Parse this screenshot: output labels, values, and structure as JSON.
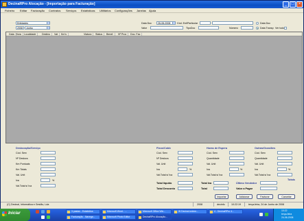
{
  "window": {
    "title": "DecinaRPro Alocação - [Importação para Facturação]",
    "controls": {
      "minimize": "_",
      "maximize": "□",
      "close": "×"
    }
  },
  "menu": [
    "Ficheiro",
    "Editar",
    "Facturação",
    "Contratos",
    "Serviços",
    "Estatísticas",
    "Utilitários",
    "Configurações",
    "Janelas",
    "Ajuda"
  ],
  "filters": {
    "type_value": "Entidades",
    "year_value": "2008",
    "month_value": "Junho",
    "data_doc_label": "Data Doc",
    "data_doc_value": "26-06-2008",
    "cod_label": "Cód. Ent/Particular",
    "valor_label": "Valor",
    "tipo_doc_label": "TipoDoc",
    "numero_label": "Número",
    "radio_data_doc": "Data Doc",
    "radio_data_transp": "Data Transp",
    "ver_todo_label": "Ver todo?"
  },
  "grid": {
    "columns": [
      "Data",
      "Hora",
      "Localidade",
      "Destino",
      "Vat",
      "Km's",
      "Viatura",
      "Status",
      "Benef.",
      "Nº Proc",
      "Doc. Fac"
    ]
  },
  "panels": {
    "desloc": {
      "title": "Deslocação/Serviço",
      "rows": [
        "Cód. Serv",
        "Nº Deslocs",
        "Km Pontuais",
        "Km Totais",
        "Val. Unit",
        "Iva",
        "Val.Total s/ Iva"
      ],
      "pct": "%"
    },
    "fixos": {
      "title": "Fixos/Cobb",
      "rows": [
        "Cód. Serv",
        "Nº Deslocs",
        "Val. Unit",
        "Iva",
        "Val.Total s/ Iva"
      ],
      "pct": "%"
    },
    "horas": {
      "title": "Horas de Espera",
      "rows": [
        "Cód. Serv",
        "Quantidade",
        "Val. Unit",
        "Iva",
        "Val.Total s/ Iva"
      ],
      "pct": "%"
    },
    "outras": {
      "title": "Outras/Ocasiões",
      "rows": [
        "Cód. Serv",
        "Quantidade",
        "Val. Unit",
        "Iva",
        "Val.Total s/ Iva"
      ],
      "pct": "%",
      "totais": "Totais"
    }
  },
  "totals": {
    "liquido": "Total liquido",
    "desconto": "Total Desconto",
    "iva": "Total Iva",
    "total": "Total",
    "ultimo_vendedor": "Último Vendedor",
    "valor_pagar": "Valor a Pagar"
  },
  "buttons": {
    "importar": "Importar",
    "adicionar": "Adicionar",
    "facturar": "Facturar",
    "cancelar": "Cancelar"
  },
  "status": {
    "company": "(C) Decinal, Informática e Gestão, Lda",
    "year": "2008",
    "user": "decinfo",
    "time": "10:22:19",
    "date": "terça-feira, 24 de Junho de 2008"
  },
  "taskbar": {
    "start": "Iniciar",
    "tasks": [
      "3 pastas - Estatística",
      "Microsoft Word - ...",
      "Microsoft Office Win...",
      "W Decinal ordem...",
      "4 - DecinaRPro 4...",
      "Facturação - Navega...",
      "Microsoft Photo Editor",
      "DecinaRPro Alocação..."
    ],
    "clock": "10:22",
    "day": "terça-feira",
    "tray_date": "24-06-2008"
  },
  "colors": {
    "titlebar": "#0a4fc4",
    "taskbar": "#245edb",
    "start": "#3c9b3c",
    "panel_title": "#2a3a9a"
  }
}
